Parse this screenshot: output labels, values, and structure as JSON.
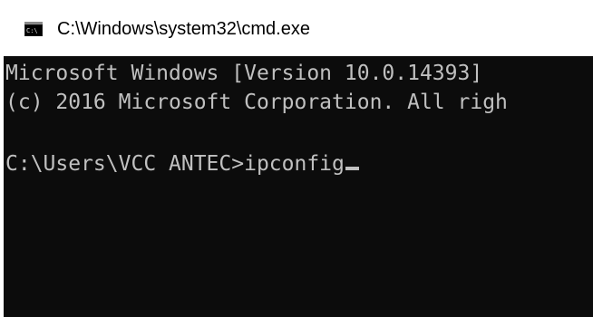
{
  "window": {
    "title": "C:\\Windows\\system32\\cmd.exe",
    "icon": "cmd-icon"
  },
  "console": {
    "lines": [
      "Microsoft Windows [Version 10.0.14393]",
      "(c) 2016 Microsoft Corporation. All righ",
      "",
      "C:\\Users\\VCC ANTEC>ipconfig"
    ],
    "background_color": "#0c0c0c",
    "text_color": "#c0c0c0"
  }
}
